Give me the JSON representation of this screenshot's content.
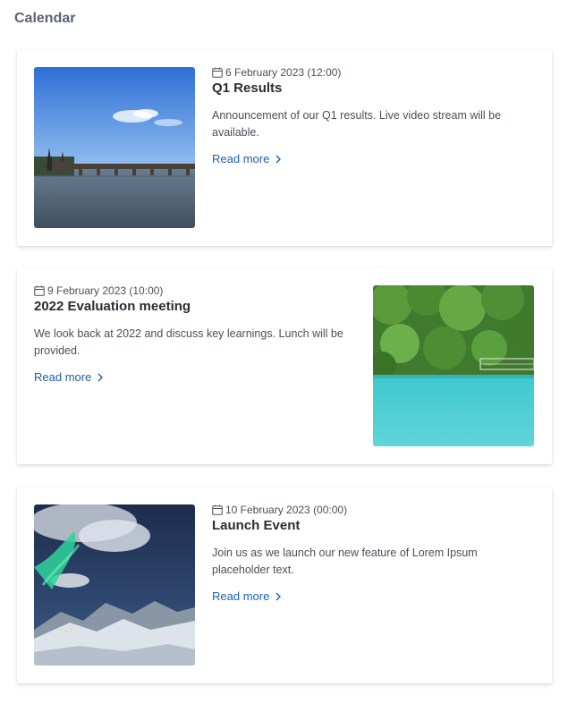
{
  "page": {
    "title": "Calendar"
  },
  "events": [
    {
      "date": "6 February 2023 (12:00)",
      "title": "Q1 Results",
      "description": "Announcement of our Q1 results. Live video stream will be available.",
      "read_more": "Read more",
      "image_icon": "bridge-photo",
      "image_side": "left"
    },
    {
      "date": "9 February 2023 (10:00)",
      "title": "2022 Evaluation meeting",
      "description": "We look back at 2022 and discuss key learnings. Lunch will be provided.",
      "read_more": "Read more",
      "image_icon": "lake-photo",
      "image_side": "right"
    },
    {
      "date": "10 February 2023 (00:00)",
      "title": "Launch Event",
      "description": "Join us as we launch our new feature of Lorem Ipsum placeholder text.",
      "read_more": "Read more",
      "image_icon": "aurora-photo",
      "image_side": "left"
    }
  ],
  "colors": {
    "link": "#1d5fb3",
    "title": "#5b6270"
  }
}
